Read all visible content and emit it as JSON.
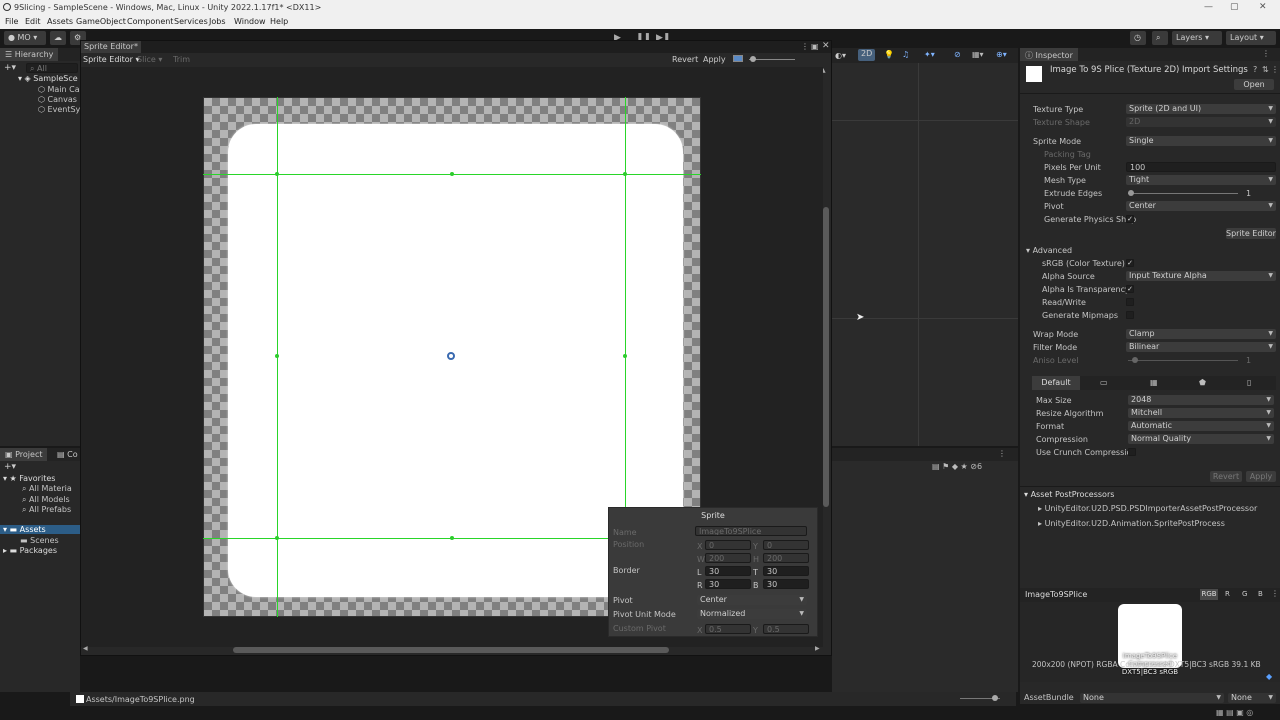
{
  "window": {
    "title": "9Slicing - SampleScene - Windows, Mac, Linux - Unity 2022.1.17f1* <DX11>"
  },
  "menu": [
    "File",
    "Edit",
    "Assets",
    "GameObject",
    "Component",
    "Services",
    "Jobs",
    "Window",
    "Help"
  ],
  "toolbar": {
    "account": "MO",
    "layers": "Layers",
    "layout": "Layout"
  },
  "hierarchy": {
    "tab": "Hierarchy",
    "search_placeholder": "All",
    "items": [
      "SampleScene",
      "Main Camera",
      "Canvas",
      "EventSystem"
    ],
    "items_display": [
      "SampleSce",
      "Main Ca",
      "Canvas",
      "EventSy"
    ]
  },
  "project": {
    "tab": "Project",
    "tab2": "Co",
    "favorites": {
      "label": "Favorites",
      "items": [
        "All Materials",
        "All Models",
        "All Prefabs"
      ],
      "items_display": [
        "All Materia",
        "All Models",
        "All Prefabs"
      ]
    },
    "assets": {
      "label": "Assets",
      "items": [
        "Scenes",
        "Packages"
      ]
    }
  },
  "sprite_editor": {
    "title": "Sprite Editor*",
    "menu_label": "Sprite Editor",
    "slice": "Slice",
    "trim": "Trim",
    "revert": "Revert",
    "apply": "Apply",
    "sprite_panel": {
      "header": "Sprite",
      "name_label": "Name",
      "name_value": "ImageTo9SPlice",
      "position_label": "Position",
      "x": "0",
      "y": "0",
      "w": "200",
      "h": "200",
      "border_label": "Border",
      "l": "30",
      "t": "30",
      "r": "30",
      "b": "30",
      "pivot_label": "Pivot",
      "pivot_value": "Center",
      "pivot_unit_label": "Pivot Unit Mode",
      "pivot_unit_value": "Normalized",
      "custom_pivot_label": "Custom Pivot",
      "cx": "0.5",
      "cy": "0.5",
      "labels_xy": {
        "x": "X",
        "y": "Y",
        "w": "W",
        "h": "H",
        "l": "L",
        "t": "T",
        "r": "R",
        "b": "B"
      }
    }
  },
  "scene_toolbar": {
    "mode_2d": "2D",
    "gizmo_count": "6"
  },
  "inspector": {
    "tab": "Inspector",
    "title": "Image To 9S Plice (Texture 2D) Import Settings",
    "open": "Open",
    "rows": [
      {
        "label": "Texture Type",
        "value": "Sprite (2D and UI)"
      },
      {
        "label": "Texture Shape",
        "value": "2D"
      },
      {
        "label": "Sprite Mode",
        "value": "Single"
      },
      {
        "label": "Packing Tag",
        "value": ""
      },
      {
        "label": "Pixels Per Unit",
        "value": "100"
      },
      {
        "label": "Mesh Type",
        "value": "Tight"
      },
      {
        "label": "Extrude Edges",
        "value": "1"
      },
      {
        "label": "Pivot",
        "value": "Center"
      },
      {
        "label": "Generate Physics Shape",
        "label_display": "Generate Physics Shap",
        "value": "✓"
      }
    ],
    "sprite_editor_button": "Sprite Editor",
    "advanced": {
      "label": "Advanced",
      "rows": [
        {
          "label": "sRGB (Color Texture)",
          "value": "✓"
        },
        {
          "label": "Alpha Source",
          "value": "Input Texture Alpha"
        },
        {
          "label": "Alpha Is Transparency",
          "value": "✓"
        },
        {
          "label": "Read/Write",
          "value": ""
        },
        {
          "label": "Generate Mipmaps",
          "value": ""
        }
      ]
    },
    "wrap_mode": {
      "label": "Wrap Mode",
      "value": "Clamp"
    },
    "filter_mode": {
      "label": "Filter Mode",
      "value": "Bilinear"
    },
    "aniso": {
      "label": "Aniso Level",
      "value": "1"
    },
    "platform_tab": "Default",
    "platform_rows": [
      {
        "label": "Max Size",
        "value": "2048"
      },
      {
        "label": "Resize Algorithm",
        "value": "Mitchell"
      },
      {
        "label": "Format",
        "value": "Automatic"
      },
      {
        "label": "Compression",
        "value": "Normal Quality"
      },
      {
        "label": "Use Crunch Compression",
        "value": ""
      }
    ],
    "revert": "Revert",
    "apply": "Apply",
    "postprocessors": {
      "label": "Asset PostProcessors",
      "items": [
        "UnityEditor.U2D.PSD.PSDImporterAssetPostProcessor",
        "UnityEditor.U2D.Animation.SpritePostProcess"
      ]
    },
    "preview": {
      "name": "ImageTo9SPlice",
      "channels": [
        "RGB",
        "R",
        "G",
        "B"
      ],
      "overlay": "ImageTo9SPlice Compressed DXT5|BC3 sRGB",
      "info": "200x200 (NPOT)  RGBA Compressed DXT5|BC3 sRGB   39.1 KB"
    },
    "assetbundle": {
      "label": "AssetBundle",
      "value": "None",
      "variant": "None"
    }
  },
  "statusbar": {
    "path": "Assets/ImageTo9SPlice.png"
  },
  "colors": {
    "slice_green": "#29d629",
    "sprite_white": "#ffffff",
    "panel_bg": "#282828"
  }
}
